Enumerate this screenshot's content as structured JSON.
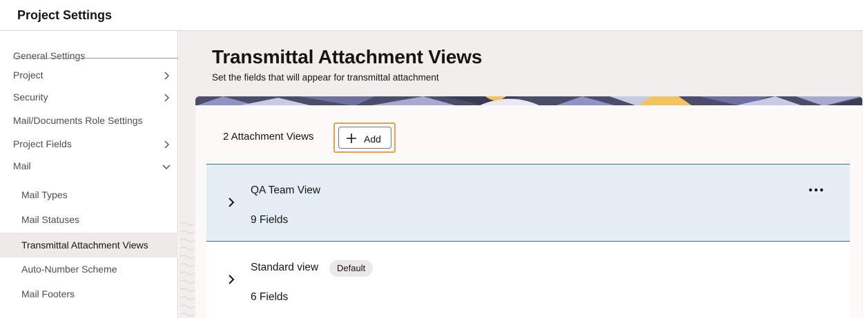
{
  "header": {
    "title": "Project Settings"
  },
  "sidebar": {
    "items": [
      {
        "label": "General Settings",
        "level": "top",
        "chevron": "none"
      },
      {
        "label": "Project",
        "level": "top",
        "chevron": "chevron-right-icon"
      },
      {
        "label": "Security",
        "level": "top",
        "chevron": "chevron-right-icon"
      },
      {
        "label": "Mail/Documents Role Settings",
        "level": "top",
        "chevron": "none"
      },
      {
        "label": "Project Fields",
        "level": "top",
        "chevron": "chevron-right-icon"
      },
      {
        "label": "Mail",
        "level": "top",
        "chevron": "chevron-down-icon"
      },
      {
        "label": "Mail Types",
        "level": "sub",
        "chevron": "none"
      },
      {
        "label": "Mail Statuses",
        "level": "sub",
        "chevron": "none"
      },
      {
        "label": "Transmittal Attachment Views",
        "level": "sub",
        "chevron": "none",
        "selected": true
      },
      {
        "label": "Auto-Number Scheme",
        "level": "sub",
        "chevron": "none"
      },
      {
        "label": "Mail Footers",
        "level": "sub",
        "chevron": "none"
      }
    ]
  },
  "main": {
    "title": "Transmittal Attachment Views",
    "subtitle": "Set the fields that will appear for transmittal attachment",
    "count_label": "2 Attachment Views",
    "add_label": "Add",
    "views": [
      {
        "name": "QA Team View",
        "fields": "9 Fields",
        "badge": "",
        "expanded": false,
        "highlighted": true
      },
      {
        "name": "Standard view",
        "fields": "6 Fields",
        "badge": "Default",
        "expanded": false,
        "highlighted": false
      }
    ]
  },
  "colors": {
    "accent_focus": "#e3a34b",
    "row_highlight": "#e4eef4",
    "row_border": "#3f6d86",
    "selected_nav": "#edebe9",
    "main_background": "#f1efed"
  }
}
